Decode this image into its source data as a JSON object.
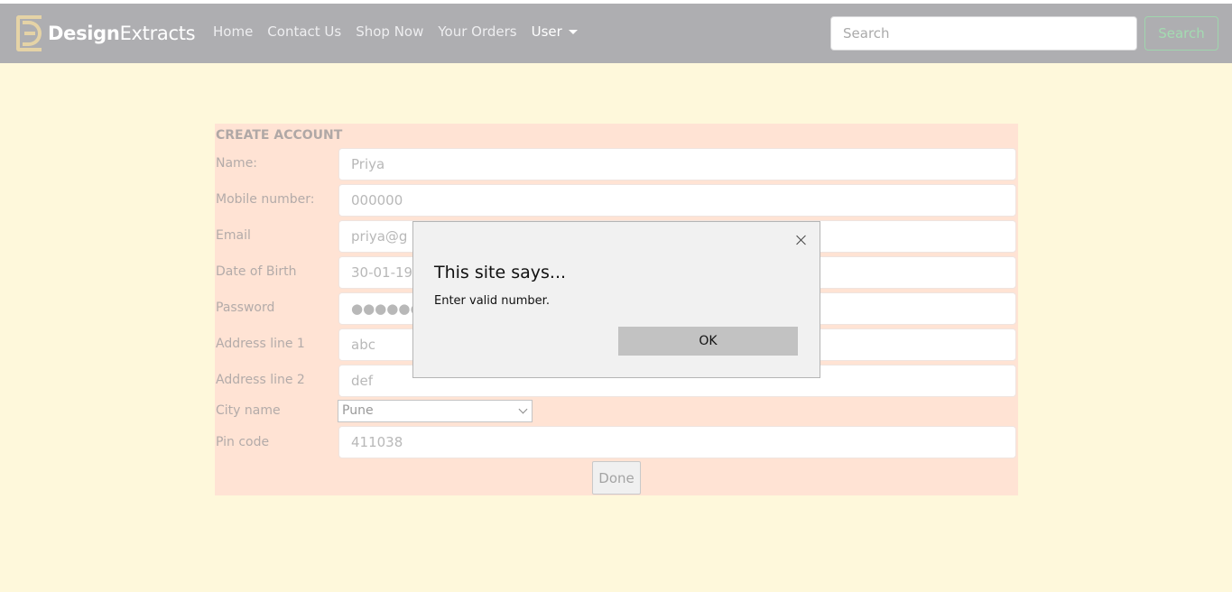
{
  "navbar": {
    "brand_part1": "Design",
    "brand_part2": "Extracts",
    "links": [
      "Home",
      "Contact Us",
      "Shop Now",
      "Your Orders"
    ],
    "user_menu": "User",
    "search_placeholder": "Search",
    "search_button": "Search"
  },
  "form": {
    "title": "CREATE ACCOUNT",
    "fields": [
      {
        "label": "Name:",
        "value": "Priya"
      },
      {
        "label": "Mobile number:",
        "value": "000000"
      },
      {
        "label": "Email",
        "value": "priya@g"
      },
      {
        "label": "Date of Birth",
        "value": "30-01-199"
      },
      {
        "label": "Password",
        "value": "●●●●●●●"
      },
      {
        "label": "Address line 1",
        "value": "abc"
      },
      {
        "label": "Address line 2",
        "value": "def"
      }
    ],
    "city": {
      "label": "City name",
      "selected": "Pune"
    },
    "pin": {
      "label": "Pin code",
      "value": "411038"
    },
    "submit": "Done"
  },
  "dialog": {
    "title": "This site says...",
    "message": "Enter valid number.",
    "ok_label": "OK"
  },
  "colors": {
    "page_bg": "#fef8db",
    "navbar_bg": "#aeaeb1",
    "form_bg": "#ffe3d4",
    "dialog_bg": "#f1f1f1",
    "search_button_border": "#9fd6ad"
  }
}
